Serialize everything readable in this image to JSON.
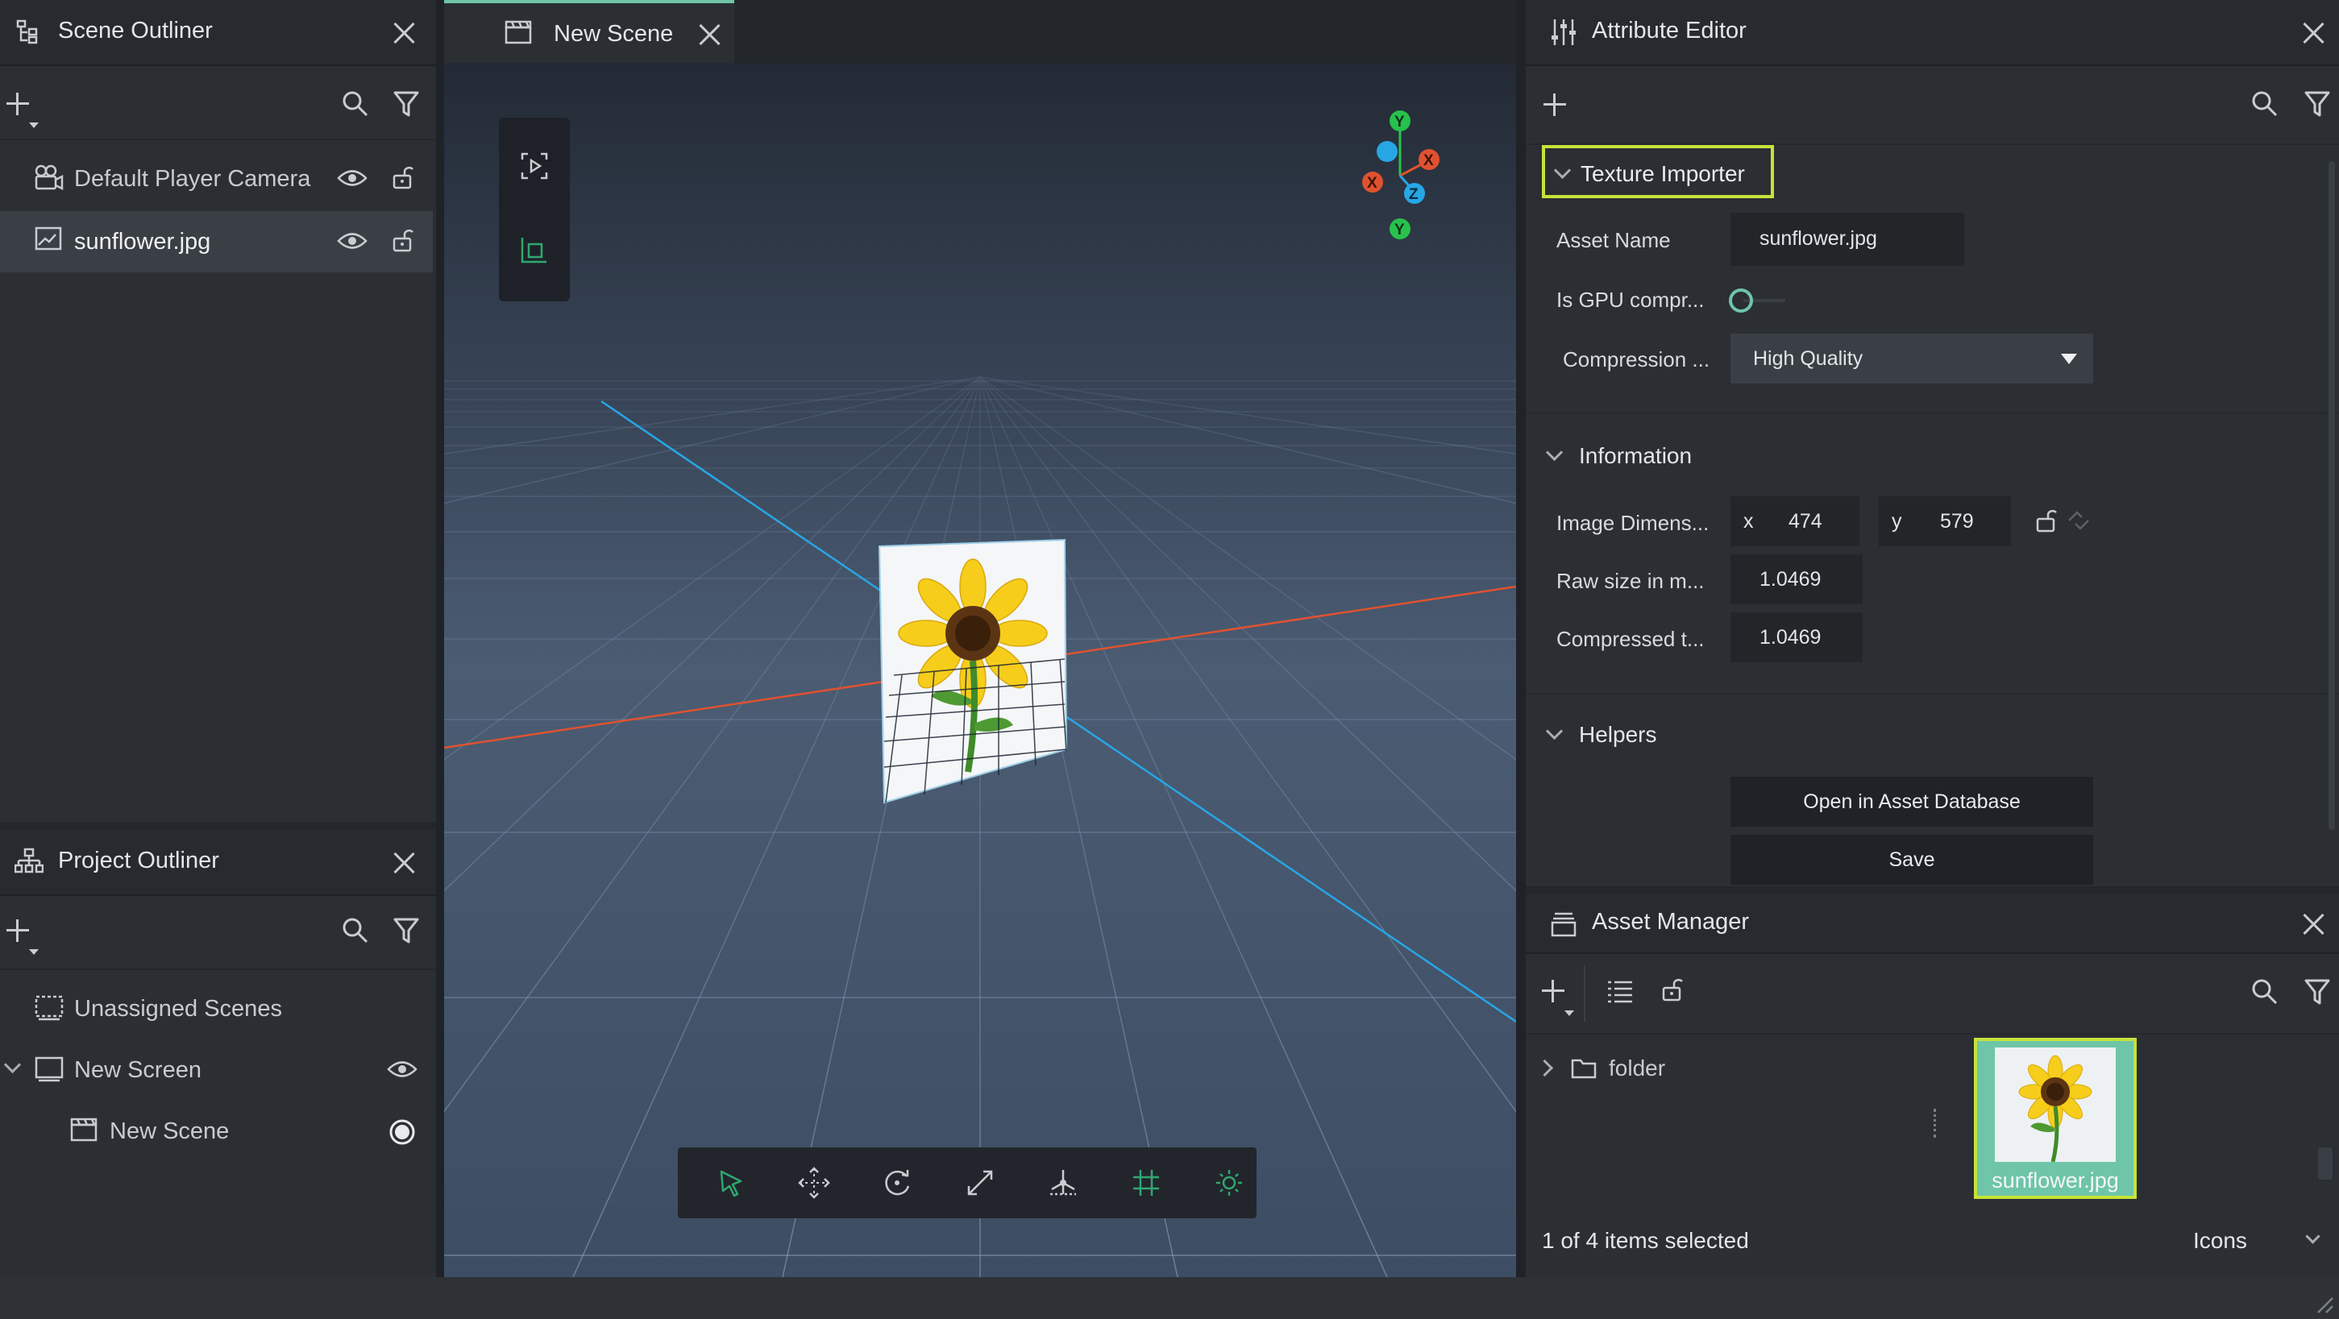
{
  "scene_outliner": {
    "title": "Scene Outliner",
    "items": [
      {
        "label": "Default Player Camera"
      },
      {
        "label": "sunflower.jpg"
      }
    ]
  },
  "project_outliner": {
    "title": "Project Outliner",
    "items": [
      {
        "label": "Unassigned Scenes"
      },
      {
        "label": "New Screen"
      },
      {
        "label": "New Scene"
      }
    ]
  },
  "viewport": {
    "tab_label": "New Scene",
    "gizmo": {
      "y": "Y",
      "x": "X",
      "z": "Z",
      "neg_x": "X",
      "neg_y": "Y"
    }
  },
  "attribute_editor": {
    "title": "Attribute Editor",
    "texture_importer": {
      "header": "Texture Importer",
      "asset_name_label": "Asset Name",
      "asset_name_value": "sunflower.jpg",
      "gpu_label": "Is GPU compr...",
      "compression_label": "Compression ...",
      "compression_value": "High Quality"
    },
    "information": {
      "header": "Information",
      "dims_label": "Image Dimens...",
      "x_label": "x",
      "x_value": "474",
      "y_label": "y",
      "y_value": "579",
      "raw_label": "Raw size in m...",
      "raw_value": "1.0469",
      "compressed_label": "Compressed t...",
      "compressed_value": "1.0469"
    },
    "helpers": {
      "header": "Helpers",
      "open_button": "Open in Asset Database",
      "save_button": "Save"
    }
  },
  "asset_manager": {
    "title": "Asset Manager",
    "folder_label": "folder",
    "thumb_label": "sunflower.jpg",
    "status": "1 of 4 items selected",
    "view_mode": "Icons"
  },
  "colors": {
    "accent_green": "#c6e23a",
    "selection": "#6ec5a8",
    "axis_red": "#e0522f",
    "axis_blue": "#27a6e6",
    "axis_green": "#27c24c"
  }
}
